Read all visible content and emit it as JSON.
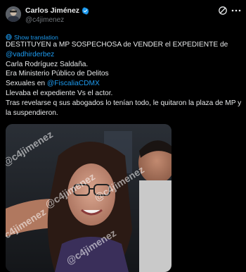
{
  "author": {
    "display_name": "Carlos Jiménez",
    "handle": "@c4jimenez",
    "verified": true
  },
  "translate": {
    "label": "Show translation"
  },
  "tweet": {
    "line1": "DESTITUYEN a MP SOSPECHOSA de VENDER el EXPEDIENTE de",
    "mention": "@vadhirderbez",
    "line3": "Carla Rodríguez Saldaña.",
    "line4": "Era Ministerio Público de Delitos",
    "line5_prefix": "Sexuales en ",
    "line5_mention": "@FiscaliaCDMX",
    "line6": "Llevaba el expediente Vs el actor.",
    "line7": "Tras revelarse q sus abogados lo tenían todo, le quitaron la plaza de MP y la suspendieron."
  },
  "photo": {
    "watermark": "@c4jimenez"
  },
  "icons": {
    "grok": "grok-icon",
    "more": "more-icon",
    "verified": "verified-badge-icon",
    "translate": "globe-icon"
  },
  "colors": {
    "background": "#000000",
    "text": "#e7e9ea",
    "muted": "#71767b",
    "link": "#1d9bf0"
  }
}
